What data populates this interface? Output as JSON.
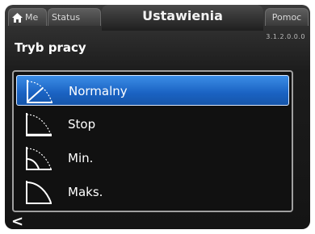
{
  "tabs": {
    "home": {
      "label": "Me",
      "icon": "home-icon"
    },
    "status": {
      "label": "Status"
    },
    "settings": {
      "label": "Ustawienia"
    },
    "help": {
      "label": "Pomoc"
    }
  },
  "menu_code": "3.1.2.0.0.0",
  "page_title": "Tryb pracy",
  "list": {
    "items": [
      {
        "label": "Normalny",
        "icon": "normal-curve-icon",
        "selected": true
      },
      {
        "label": "Stop",
        "icon": "stop-curve-icon",
        "selected": false
      },
      {
        "label": "Min.",
        "icon": "min-curve-icon",
        "selected": false
      },
      {
        "label": "Maks.",
        "icon": "max-curve-icon",
        "selected": false
      }
    ]
  },
  "back_icon": "<",
  "colors": {
    "selection": "#1a62c2",
    "background": "#141414",
    "text": "#ffffff"
  }
}
